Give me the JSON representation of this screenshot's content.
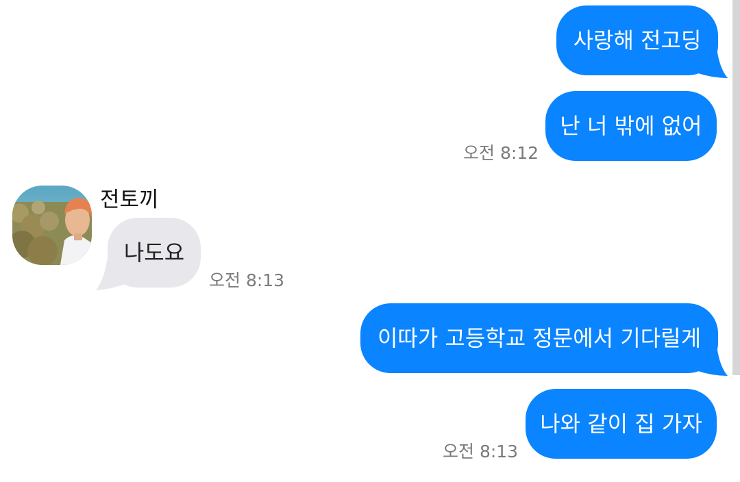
{
  "conversation": {
    "messages": [
      {
        "text": "사랑해 전고딩"
      },
      {
        "text": "난 너 밖에 없어",
        "time": "오전 8:12"
      },
      {
        "sender": "전토끼",
        "text": "나도요",
        "time": "오전 8:13"
      },
      {
        "text": "이따가 고등학교 정문에서 기다릴게"
      },
      {
        "text": "나와 같이 집 가자",
        "time": "오전 8:13"
      }
    ]
  },
  "colors": {
    "outgoing_bubble": "#0a84ff",
    "incoming_bubble": "#e8e8ec",
    "timestamp": "#7a7a7a"
  },
  "icons": {
    "contact_avatar": "avatar-photo"
  }
}
